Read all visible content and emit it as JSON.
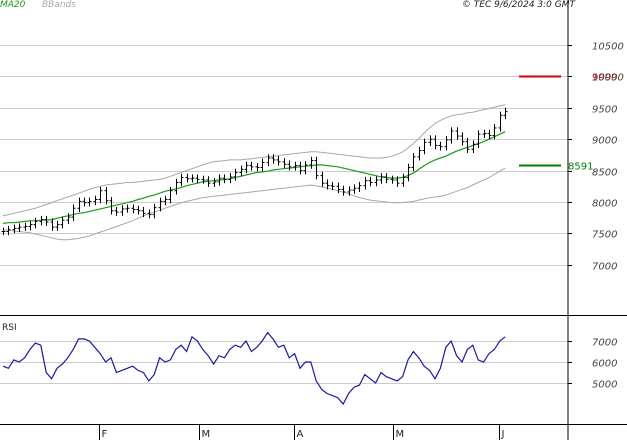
{
  "header": {
    "ma_label": "MA20",
    "bb_label": "BBands",
    "info": "© TEC 9/6/2024 3:0 GMT"
  },
  "colors": {
    "price": "#000000",
    "ma": "#1a9a1a",
    "bbands": "#a8a8a8",
    "rsi": "#1a1aa0",
    "resistance": "#cc0000",
    "support": "#008000",
    "grid": "#cccccc"
  },
  "chart_data": [
    {
      "type": "ohlc",
      "x_tick_labels": [
        "F",
        "M",
        "A",
        "M",
        "J"
      ],
      "y_tick_labels": [
        "10500",
        "10000",
        "9500",
        "9000",
        "8500",
        "8000",
        "7500",
        "7000"
      ],
      "ylim": [
        6600,
        10800
      ],
      "annotations": [
        {
          "label": "9999",
          "value": 9999,
          "kind": "resistance"
        },
        {
          "label": "8591",
          "value": 8591,
          "kind": "support"
        }
      ],
      "legend": [
        "MA20",
        "BBands"
      ],
      "grid": true,
      "close": [
        7530,
        7560,
        7580,
        7600,
        7610,
        7640,
        7690,
        7720,
        7680,
        7600,
        7640,
        7710,
        7760,
        7900,
        8010,
        7990,
        8010,
        8040,
        8180,
        8020,
        7860,
        7840,
        7890,
        7900,
        7880,
        7860,
        7820,
        7800,
        7910,
        8010,
        8040,
        8180,
        8310,
        8390,
        8370,
        8380,
        8360,
        8350,
        8300,
        8320,
        8380,
        8360,
        8400,
        8470,
        8520,
        8580,
        8560,
        8550,
        8630,
        8700,
        8670,
        8640,
        8600,
        8560,
        8580,
        8500,
        8590,
        8660,
        8420,
        8300,
        8260,
        8250,
        8200,
        8160,
        8190,
        8220,
        8260,
        8340,
        8310,
        8350,
        8400,
        8360,
        8350,
        8300,
        8390,
        8550,
        8720,
        8820,
        8950,
        9000,
        8900,
        8880,
        8990,
        9130,
        9050,
        8960,
        8840,
        8920,
        9080,
        9090,
        9060,
        9180,
        9380,
        9440
      ],
      "ma20": [
        7660,
        7670,
        7670,
        7680,
        7690,
        7700,
        7700,
        7710,
        7710,
        7720,
        7740,
        7760,
        7780,
        7800,
        7820,
        7830,
        7850,
        7870,
        7890,
        7910,
        7930,
        7950,
        7970,
        7990,
        8010,
        8040,
        8060,
        8090,
        8110,
        8140,
        8170,
        8190,
        8210,
        8230,
        8260,
        8280,
        8300,
        8320,
        8330,
        8340,
        8350,
        8360,
        8370,
        8390,
        8410,
        8430,
        8450,
        8470,
        8480,
        8490,
        8510,
        8520,
        8530,
        8540,
        8550,
        8560,
        8570,
        8580,
        8590,
        8590,
        8580,
        8570,
        8560,
        8540,
        8520,
        8500,
        8480,
        8460,
        8440,
        8420,
        8400,
        8390,
        8380,
        8380,
        8390,
        8420,
        8460,
        8520,
        8580,
        8630,
        8670,
        8700,
        8730,
        8770,
        8810,
        8840,
        8870,
        8900,
        8930,
        8960,
        9000,
        9040,
        9080,
        9120
      ],
      "bb_upper": [
        7780,
        7800,
        7820,
        7840,
        7860,
        7880,
        7900,
        7930,
        7960,
        7990,
        8020,
        8050,
        8080,
        8110,
        8140,
        8170,
        8200,
        8230,
        8250,
        8270,
        8280,
        8290,
        8300,
        8310,
        8310,
        8320,
        8330,
        8340,
        8350,
        8360,
        8380,
        8410,
        8440,
        8470,
        8500,
        8530,
        8560,
        8590,
        8620,
        8640,
        8650,
        8660,
        8670,
        8670,
        8670,
        8680,
        8690,
        8700,
        8710,
        8720,
        8730,
        8740,
        8750,
        8760,
        8770,
        8780,
        8790,
        8800,
        8800,
        8790,
        8780,
        8770,
        8760,
        8750,
        8740,
        8730,
        8720,
        8710,
        8700,
        8700,
        8700,
        8710,
        8730,
        8760,
        8800,
        8860,
        8930,
        9010,
        9100,
        9180,
        9250,
        9300,
        9340,
        9370,
        9390,
        9400,
        9420,
        9430,
        9450,
        9470,
        9490,
        9510,
        9530,
        9550
      ],
      "bb_lower": [
        7560,
        7550,
        7540,
        7530,
        7520,
        7510,
        7490,
        7470,
        7450,
        7430,
        7410,
        7400,
        7400,
        7410,
        7420,
        7440,
        7460,
        7490,
        7520,
        7550,
        7580,
        7610,
        7640,
        7670,
        7700,
        7740,
        7780,
        7810,
        7840,
        7870,
        7900,
        7930,
        7960,
        7990,
        8010,
        8030,
        8050,
        8070,
        8080,
        8090,
        8100,
        8110,
        8120,
        8130,
        8140,
        8150,
        8160,
        8170,
        8180,
        8190,
        8200,
        8210,
        8220,
        8230,
        8240,
        8250,
        8260,
        8270,
        8260,
        8240,
        8220,
        8200,
        8180,
        8160,
        8130,
        8100,
        8070,
        8050,
        8030,
        8020,
        8010,
        8000,
        7990,
        7990,
        7990,
        8000,
        8010,
        8030,
        8050,
        8070,
        8080,
        8090,
        8110,
        8140,
        8170,
        8200,
        8230,
        8270,
        8310,
        8350,
        8390,
        8440,
        8490,
        8540
      ]
    },
    {
      "type": "line",
      "label": "RSI",
      "y_tick_labels": [
        "7000",
        "6000",
        "5000"
      ],
      "ylim": [
        38,
        83
      ],
      "values": [
        58,
        57,
        61,
        60,
        62,
        66,
        69,
        68,
        55,
        52,
        57,
        59,
        62,
        66,
        71,
        71,
        70,
        67,
        64,
        60,
        62,
        55,
        56,
        57,
        58,
        56,
        55,
        51,
        54,
        62,
        60,
        61,
        66,
        68,
        65,
        72,
        70,
        66,
        63,
        59,
        63,
        62,
        66,
        68,
        67,
        70,
        65,
        67,
        70,
        74,
        71,
        67,
        68,
        62,
        64,
        57,
        60,
        60,
        51,
        47,
        45,
        44,
        43,
        40,
        45,
        48,
        49,
        54,
        52,
        50,
        55,
        53,
        52,
        51,
        53,
        61,
        65,
        62,
        58,
        56,
        52,
        57,
        67,
        70,
        63,
        60,
        66,
        68,
        61,
        60,
        64,
        66,
        70,
        72
      ]
    }
  ]
}
